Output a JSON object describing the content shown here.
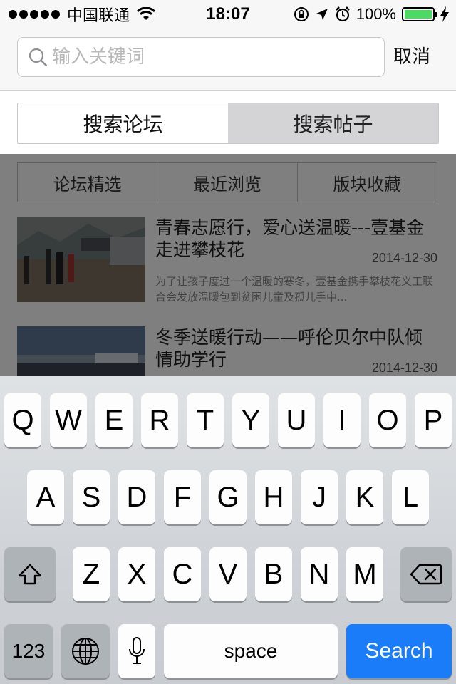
{
  "status_bar": {
    "carrier": "中国联通",
    "time": "18:07",
    "battery_percent": "100%",
    "battery_level": 1.0,
    "signal_dots": 5,
    "icons": [
      "wifi-icon",
      "orientation-lock-icon",
      "location-arrow-icon",
      "alarm-icon",
      "charging-bolt-icon"
    ],
    "battery_color": "#4cd964"
  },
  "search": {
    "placeholder": "输入关键词",
    "value": "",
    "cancel_label": "取消",
    "icon": "search-icon"
  },
  "segment": {
    "options": [
      "搜索论坛",
      "搜索帖子"
    ],
    "selected": "搜索论坛"
  },
  "tabs": [
    "论坛精选",
    "最近浏览",
    "版块收藏"
  ],
  "articles": [
    {
      "title": "青春志愿行，爱心送温暖---壹基金走进攀枝花",
      "date": "2014-12-30",
      "summary": "为了让孩子度过一个温暖的寒冬，壹基金携手攀枝花义工联合会发放温暖包到贫困儿童及孤儿手中..."
    },
    {
      "title": "冬季送暖行动——呼伦贝尔中队倾情助学行",
      "date": "2014-12-30",
      "summary": ""
    }
  ],
  "keyboard": {
    "row1": [
      "Q",
      "W",
      "E",
      "R",
      "T",
      "Y",
      "U",
      "I",
      "O",
      "P"
    ],
    "row2": [
      "A",
      "S",
      "D",
      "F",
      "G",
      "H",
      "J",
      "K",
      "L"
    ],
    "row3": [
      "Z",
      "X",
      "C",
      "V",
      "B",
      "N",
      "M"
    ],
    "numbers_label": "123",
    "space_label": "space",
    "search_label": "Search",
    "search_color": "#1a7cf8"
  }
}
